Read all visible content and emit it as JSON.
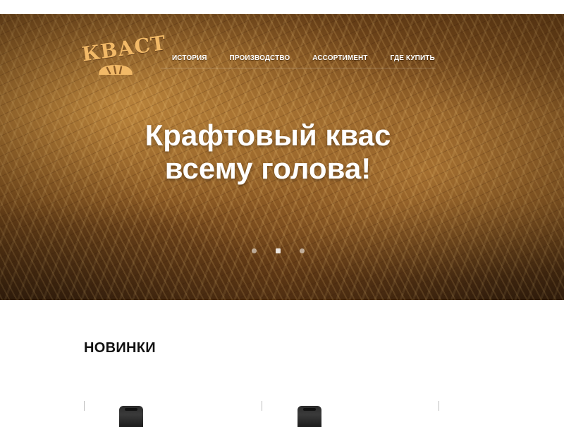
{
  "brand": {
    "logo_text": "КВАСТ"
  },
  "nav": {
    "items": [
      {
        "label": "История"
      },
      {
        "label": "Производство"
      },
      {
        "label": "Ассортимент"
      },
      {
        "label": "Где купить"
      }
    ]
  },
  "hero": {
    "headline_line1": "Крафтовый квас",
    "headline_line2": "всему голова!",
    "slider": {
      "slide_count": 3,
      "active_index": 1
    }
  },
  "new_products": {
    "title": "НОВИНКИ"
  },
  "colors": {
    "logo": "#f2b967",
    "hero_text": "#ffffff",
    "section_title": "#111111"
  },
  "icons": [
    "bread-loaf-icon"
  ]
}
